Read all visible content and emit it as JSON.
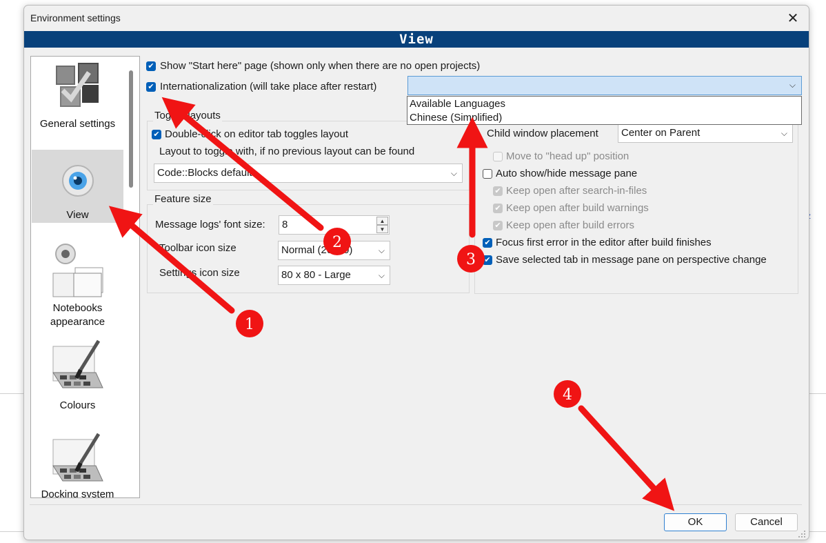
{
  "dialog": {
    "title": "Environment settings",
    "close_glyph": "✕",
    "banner": "View"
  },
  "sidebar": {
    "items": [
      {
        "label": "General settings",
        "icon": "general-settings-icon"
      },
      {
        "label": "View",
        "icon": "eye-icon",
        "selected": true
      },
      {
        "label": "Notebooks appearance",
        "icon": "notebooks-icon"
      },
      {
        "label": "Colours",
        "icon": "palette-icon"
      },
      {
        "label": "Docking system",
        "icon": "docking-icon"
      }
    ]
  },
  "options": {
    "show_start_here": "Show \"Start here\" page (shown only when there are no open projects)",
    "internationalization": "Internationalization (will take place after restart)",
    "language_dropdown": {
      "selected": "",
      "options": [
        "Available Languages",
        "Chinese (Simplified)"
      ]
    }
  },
  "toggle_layouts": {
    "group_label": "Toggle layouts",
    "double_click": "Double-click on editor tab toggles layout",
    "layout_label": "Layout to toggle with, if no previous layout can be found",
    "layout_value": "Code::Blocks default"
  },
  "feature_size": {
    "group_label": "Feature size",
    "font_size_label": "Message logs' font size:",
    "font_size_value": "8",
    "toolbar_label": "Toolbar icon size",
    "toolbar_value": "Normal (20x20)",
    "settings_label": "Settings icon size",
    "settings_value": "80 x 80 - Large"
  },
  "message_pane": {
    "child_window_label": "Child window placement",
    "child_window_value": "Center on Parent",
    "move_head_up": "Move to \"head up\" position",
    "auto_show_hide": "Auto show/hide message pane",
    "keep_open_search": "Keep open after search-in-files",
    "keep_open_warnings": "Keep open after build warnings",
    "keep_open_errors": "Keep open after build errors",
    "focus_first_error": "Focus first error in the editor after build finishes",
    "save_selected_tab": "Save selected tab in message pane on perspective change"
  },
  "buttons": {
    "ok": "OK",
    "cancel": "Cancel"
  },
  "annotations": {
    "color": "#f01414",
    "markers": [
      "1",
      "2",
      "3",
      "4"
    ]
  },
  "background": {
    "edge_text": "z"
  }
}
